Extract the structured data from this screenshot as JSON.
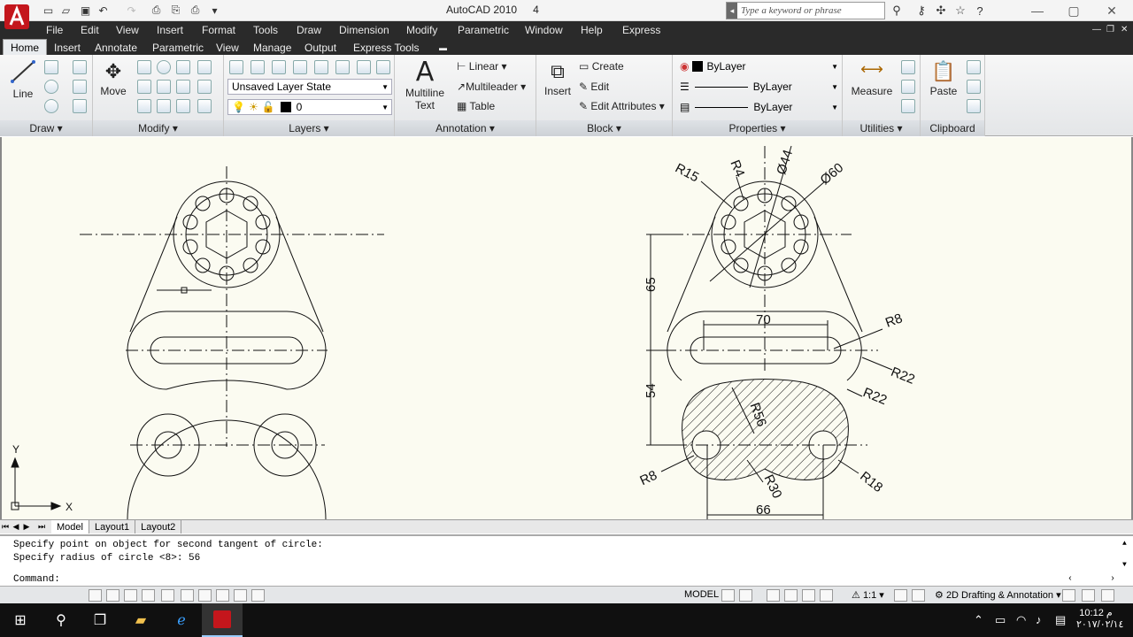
{
  "app": {
    "title": "AutoCAD 2010",
    "title_suffix": "4",
    "search_placeholder": "Type a keyword or phrase"
  },
  "menu": [
    "File",
    "Edit",
    "View",
    "Insert",
    "Format",
    "Tools",
    "Draw",
    "Dimension",
    "Modify",
    "Parametric",
    "Window",
    "Help",
    "Express"
  ],
  "tabs": [
    "Home",
    "Insert",
    "Annotate",
    "Parametric",
    "View",
    "Manage",
    "Output",
    "Express Tools"
  ],
  "ribbon": {
    "draw": {
      "title": "Draw",
      "line": "Line"
    },
    "modify": {
      "title": "Modify",
      "move": "Move"
    },
    "layers": {
      "title": "Layers",
      "layer_state": "Unsaved Layer State",
      "current_layer": "0"
    },
    "annotation": {
      "title": "Annotation",
      "mtext_line1": "Multiline",
      "mtext_line2": "Text",
      "linear": "Linear",
      "multileader": "Multileader",
      "table": "Table"
    },
    "block": {
      "title": "Block",
      "insert": "Insert",
      "create": "Create",
      "edit": "Edit",
      "edit_attributes": "Edit Attributes"
    },
    "properties": {
      "title": "Properties",
      "color": "ByLayer",
      "linetype": "ByLayer",
      "lineweight": "ByLayer"
    },
    "utilities": {
      "title": "Utilities",
      "measure": "Measure"
    },
    "clipboard": {
      "title": "Clipboard",
      "paste": "Paste"
    }
  },
  "layout_tabs": [
    "Model",
    "Layout1",
    "Layout2"
  ],
  "axis": {
    "x": "X",
    "y": "Y"
  },
  "dimensions": {
    "r15": "R15",
    "r4": "R4",
    "d44": "Ø44",
    "d60": "Ø60",
    "d65": "65",
    "d70": "70",
    "r8a": "R8",
    "r22a": "R22",
    "r22b": "R22",
    "d54": "54",
    "r56": "R56",
    "r8b": "R8",
    "r30": "R30",
    "r18": "R18",
    "d66": "66"
  },
  "command": {
    "history": [
      "Specify point on object for second tangent of circle:",
      "Specify radius of circle <8>: 56"
    ],
    "prompt": "Command:"
  },
  "status": {
    "model": "MODEL",
    "scale": "1:1",
    "workspace": "2D Drafting & Annotation"
  },
  "taskbar": {
    "time": "10:12 م",
    "date": "٢٠١٧/٠٢/١٤"
  }
}
